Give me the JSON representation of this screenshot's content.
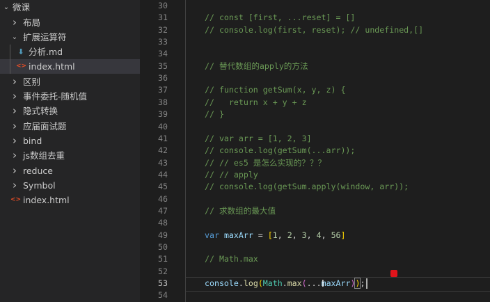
{
  "explorer": {
    "root": {
      "label": "微课",
      "chevron": "chevron-down"
    },
    "items": [
      {
        "label": "布局",
        "type": "folder",
        "state": "collapsed"
      },
      {
        "label": "扩展运算符",
        "type": "folder",
        "state": "expanded"
      },
      {
        "label": "分析.md",
        "type": "file",
        "icon": "markdown-icon",
        "icon_color": "#519aba"
      },
      {
        "label": "index.html",
        "type": "file",
        "icon": "html-icon",
        "icon_color": "#e44d26",
        "selected": true
      },
      {
        "label": "区别",
        "type": "folder",
        "state": "collapsed"
      },
      {
        "label": "事件委托-随机值",
        "type": "folder",
        "state": "collapsed"
      },
      {
        "label": "隐式转换",
        "type": "folder",
        "state": "collapsed"
      },
      {
        "label": "应届面试题",
        "type": "folder",
        "state": "collapsed"
      },
      {
        "label": "bind",
        "type": "folder",
        "state": "collapsed"
      },
      {
        "label": "js数组去重",
        "type": "folder",
        "state": "collapsed"
      },
      {
        "label": "reduce",
        "type": "folder",
        "state": "collapsed"
      },
      {
        "label": "Symbol",
        "type": "folder",
        "state": "collapsed"
      },
      {
        "label": "index.html",
        "type": "file",
        "icon": "html-icon",
        "icon_color": "#e44d26"
      }
    ]
  },
  "editor": {
    "current_line": 53,
    "lines": [
      {
        "n": "30",
        "tokens": []
      },
      {
        "n": "31",
        "tokens": [
          {
            "t": "// const [first, ...reset] = []",
            "c": "cmt"
          }
        ]
      },
      {
        "n": "32",
        "tokens": [
          {
            "t": "// console.log(first, reset); // undefined,[]",
            "c": "cmt"
          }
        ]
      },
      {
        "n": "33",
        "tokens": []
      },
      {
        "n": "34",
        "tokens": []
      },
      {
        "n": "35",
        "tokens": [
          {
            "t": "// 替代数组的apply的方法",
            "c": "cmt"
          }
        ]
      },
      {
        "n": "36",
        "tokens": []
      },
      {
        "n": "37",
        "tokens": [
          {
            "t": "// function getSum(x, y, z) {",
            "c": "cmt"
          }
        ]
      },
      {
        "n": "38",
        "tokens": [
          {
            "t": "//   return x + y + z",
            "c": "cmt"
          }
        ]
      },
      {
        "n": "39",
        "tokens": [
          {
            "t": "// }",
            "c": "cmt"
          }
        ]
      },
      {
        "n": "40",
        "tokens": []
      },
      {
        "n": "41",
        "tokens": [
          {
            "t": "// var arr = [1, 2, 3]",
            "c": "cmt"
          }
        ]
      },
      {
        "n": "42",
        "tokens": [
          {
            "t": "// console.log(getSum(...arr));",
            "c": "cmt"
          }
        ]
      },
      {
        "n": "43",
        "tokens": [
          {
            "t": "// // es5 是怎么实现的？？？",
            "c": "cmt"
          }
        ]
      },
      {
        "n": "44",
        "tokens": [
          {
            "t": "// // apply",
            "c": "cmt"
          }
        ]
      },
      {
        "n": "45",
        "tokens": [
          {
            "t": "// console.log(getSum.apply(window, arr));",
            "c": "cmt"
          }
        ]
      },
      {
        "n": "46",
        "tokens": []
      },
      {
        "n": "47",
        "tokens": [
          {
            "t": "// 求数组的最大值",
            "c": "cmt"
          }
        ]
      },
      {
        "n": "48",
        "tokens": []
      },
      {
        "n": "49",
        "tokens": [
          {
            "t": "var",
            "c": "kw"
          },
          {
            "t": " ",
            "c": "pl"
          },
          {
            "t": "maxArr",
            "c": "var"
          },
          {
            "t": " = ",
            "c": "pl"
          },
          {
            "t": "[",
            "c": "br1"
          },
          {
            "t": "1",
            "c": "num"
          },
          {
            "t": ", ",
            "c": "pl"
          },
          {
            "t": "2",
            "c": "num"
          },
          {
            "t": ", ",
            "c": "pl"
          },
          {
            "t": "3",
            "c": "num"
          },
          {
            "t": ", ",
            "c": "pl"
          },
          {
            "t": "4",
            "c": "num"
          },
          {
            "t": ", ",
            "c": "pl"
          },
          {
            "t": "56",
            "c": "num"
          },
          {
            "t": "]",
            "c": "br1"
          }
        ]
      },
      {
        "n": "50",
        "tokens": []
      },
      {
        "n": "51",
        "tokens": [
          {
            "t": "// Math.max",
            "c": "cmt"
          }
        ]
      },
      {
        "n": "52",
        "tokens": []
      },
      {
        "n": "53",
        "tokens": [
          {
            "t": "console",
            "c": "var"
          },
          {
            "t": ".",
            "c": "pl"
          },
          {
            "t": "log",
            "c": "fn"
          },
          {
            "t": "(",
            "c": "br1"
          },
          {
            "t": "Math",
            "c": "cls"
          },
          {
            "t": ".",
            "c": "pl"
          },
          {
            "t": "max",
            "c": "fn"
          },
          {
            "t": "(",
            "c": "br2"
          },
          {
            "t": "...",
            "c": "pl"
          },
          {
            "t": "maxArr",
            "c": "var"
          },
          {
            "t": ")",
            "c": "br2"
          },
          {
            "t": ")",
            "c": "br1 bm"
          },
          {
            "t": ";",
            "c": "pl"
          }
        ]
      },
      {
        "n": "54",
        "tokens": []
      }
    ]
  }
}
